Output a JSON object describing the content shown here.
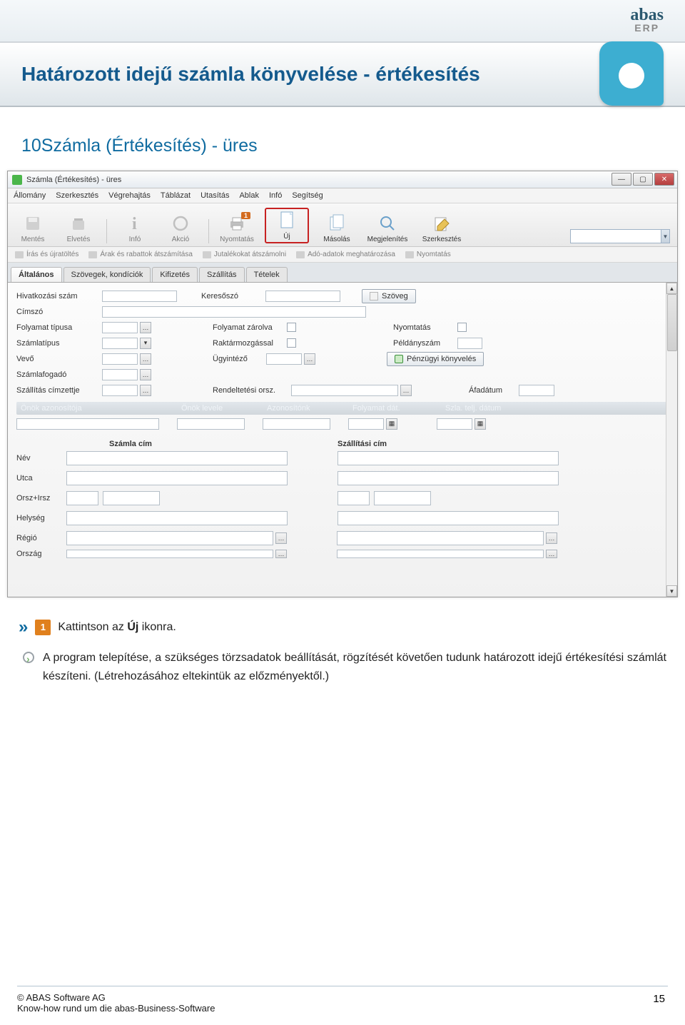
{
  "logo": {
    "word": "abas",
    "sub": "ERP"
  },
  "title": "Határozott idejű számla könyvelése - értékesítés",
  "heading": "10Számla (Értékesítés) - üres",
  "window": {
    "title": "Számla (Értékesítés) - üres",
    "menu": [
      "Állomány",
      "Szerkesztés",
      "Végrehajtás",
      "Táblázat",
      "Utasítás",
      "Ablak",
      "Infó",
      "Segítség"
    ],
    "toolbar": {
      "save": "Mentés",
      "discard": "Elvetés",
      "info": "Infó",
      "action": "Akció",
      "print": "Nyomtatás",
      "badge": "1",
      "new": "Új",
      "copy": "Másolás",
      "show": "Megjelenítés",
      "edit": "Szerkesztés"
    },
    "actionbar": [
      "Írás és újratöltés",
      "Árak és rabattok átszámítása",
      "Jutalékokat átszámolni",
      "Adó-adatok meghatározása",
      "Nyomtatás"
    ],
    "tabs": [
      "Általános",
      "Szövegek, kondíciók",
      "Kifizetés",
      "Szállítás",
      "Tételek"
    ],
    "labels": {
      "hivszam": "Hivatkozási szám",
      "keresoszo": "Keresőszó",
      "szoveg": "Szöveg",
      "cimszo": "Címszó",
      "folyamattipus": "Folyamat típusa",
      "folyamatzarolva": "Folyamat zárolva",
      "nyomtatas": "Nyomtatás",
      "szamlatipus": "Számlatípus",
      "raktarmozgassal": "Raktármozgással",
      "peldanyszam": "Példányszám",
      "vevo": "Vevő",
      "ugyintezo": "Ügyintéző",
      "penzugyi": "Pénzügyi könyvelés",
      "szamlafogado": "Számlafogadó",
      "szallcimz": "Szállítás címzettje",
      "rendelorsz": "Rendeltetési orsz.",
      "afadatum": "Áfadátum",
      "onokaz": "Önök azonosítója",
      "onoklevele": "Önök levele",
      "azonositonk": "Azonosítónk",
      "folydat": "Folyamat dát.",
      "szlatelj": "Szla. telj. dátum",
      "szamlacim": "Számla cím",
      "szallcim": "Szállítási cím",
      "nev": "Név",
      "utca": "Utca",
      "orszirsz": "Orsz+Irsz",
      "helyseg": "Helység",
      "regio": "Régió",
      "orszag": "Ország"
    }
  },
  "notes": {
    "line1_pre": "Kattintson  az  ",
    "line1_bold": "Új",
    "line1_post": "  ikonra.",
    "para": "A program telepítése, a szükséges törzsadatok beállítását, rögzítését követően tudunk határozott idejű értékesítési számlát készíteni. (Létrehozásához eltekintük az előzményektől.)"
  },
  "footer": {
    "copyright": "© ABAS Software AG",
    "sub": "Know-how rund um die abas-Business-Software",
    "page": "15"
  }
}
